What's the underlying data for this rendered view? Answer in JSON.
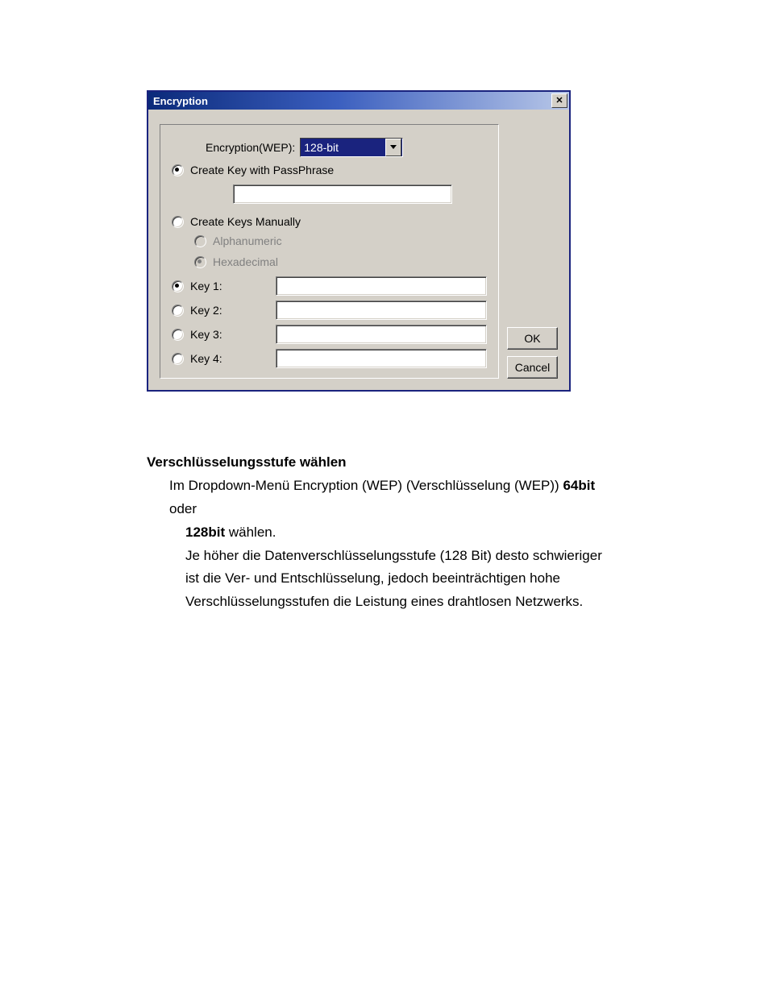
{
  "dialog": {
    "title": "Encryption",
    "encryption_label": "Encryption(WEP):",
    "encryption_value": "128-bit",
    "opt_passphrase": "Create Key with PassPhrase",
    "passphrase_value": "",
    "opt_manual": "Create Keys Manually",
    "sub_alpha": "Alphanumeric",
    "sub_hex": "Hexadecimal",
    "keys": [
      {
        "label": "Key 1:",
        "value": ""
      },
      {
        "label": "Key 2:",
        "value": ""
      },
      {
        "label": "Key 3:",
        "value": ""
      },
      {
        "label": "Key 4:",
        "value": ""
      }
    ],
    "ok_label": "OK",
    "cancel_label": "Cancel"
  },
  "doc": {
    "heading": "Verschlüsselungsstufe wählen",
    "line1_a": "Im Dropdown-Menü Encryption (WEP) (Verschlüsselung (WEP)) ",
    "line1_b": "64bit",
    "line1_c": " oder",
    "line2_a": "128bit",
    "line2_b": " wählen.",
    "para2_l1": "Je höher die Datenverschlüsselungsstufe (128 Bit) desto schwieriger",
    "para2_l2": "ist die Ver- und Entschlüsselung, jedoch beeinträchtigen hohe",
    "para2_l3": "Verschlüsselungsstufen die Leistung eines drahtlosen Netzwerks."
  }
}
